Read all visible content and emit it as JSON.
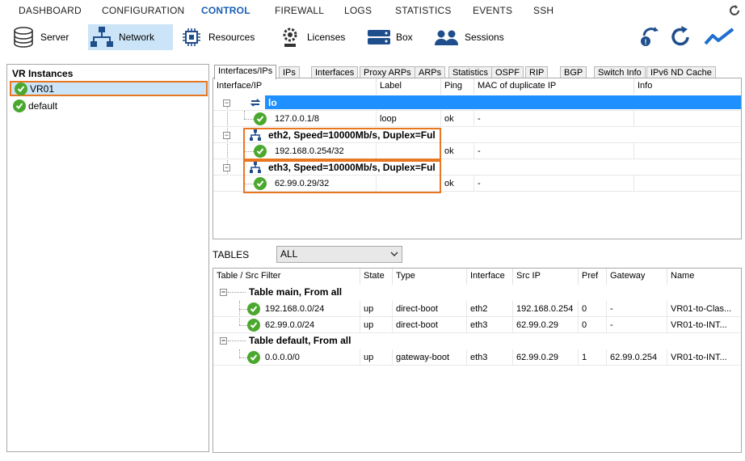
{
  "nav": {
    "items": [
      "DASHBOARD",
      "CONFIGURATION",
      "CONTROL",
      "FIREWALL",
      "LOGS",
      "STATISTICS",
      "EVENTS",
      "SSH"
    ],
    "active": "CONTROL"
  },
  "toolbar": {
    "buttons": [
      {
        "label": "Server",
        "icon": "server-icon"
      },
      {
        "label": "Network",
        "icon": "network-icon"
      },
      {
        "label": "Resources",
        "icon": "chip-icon"
      },
      {
        "label": "Licenses",
        "icon": "gear-license-icon"
      },
      {
        "label": "Box",
        "icon": "box-icon"
      },
      {
        "label": "Sessions",
        "icon": "users-icon"
      }
    ],
    "selected": "Network"
  },
  "vr": {
    "title": "VR Instances",
    "items": [
      {
        "label": "VR01",
        "selected": true
      },
      {
        "label": "default",
        "selected": false
      }
    ]
  },
  "tabs": [
    "Interfaces/IPs",
    "IPs",
    "Interfaces",
    "Proxy ARPs",
    "ARPs",
    "Statistics",
    "OSPF",
    "RIP",
    "BGP",
    "Switch Info",
    "IPv6 ND Cache"
  ],
  "interfaces": {
    "headers": [
      "Interface/IP",
      "Label",
      "Ping",
      "MAC of duplicate IP",
      "Info"
    ],
    "groups": [
      {
        "name": "lo",
        "selected": true,
        "rows": [
          {
            "ip": "127.0.0.1/8",
            "label": "loop",
            "ping": "ok",
            "mac": "-",
            "info": ""
          }
        ]
      },
      {
        "name": "eth2, Speed=10000Mb/s, Duplex=Ful",
        "selected": false,
        "rows": [
          {
            "ip": "192.168.0.254/32",
            "label": "",
            "ping": "ok",
            "mac": "-",
            "info": ""
          }
        ]
      },
      {
        "name": "eth3, Speed=10000Mb/s, Duplex=Ful",
        "selected": false,
        "rows": [
          {
            "ip": "62.99.0.29/32",
            "label": "",
            "ping": "ok",
            "mac": "-",
            "info": ""
          }
        ]
      }
    ]
  },
  "tables": {
    "label": "TABLES",
    "filter": "ALL",
    "headers": [
      "Table / Src Filter",
      "State",
      "Type",
      "Interface",
      "Src IP",
      "Pref",
      "Gateway",
      "Name"
    ],
    "groups": [
      {
        "name": "Table main, From all",
        "rows": [
          {
            "dest": "192.168.0.0/24",
            "state": "up",
            "type": "direct-boot",
            "iface": "eth2",
            "src": "192.168.0.254",
            "pref": "0",
            "gw": "-",
            "name": "VR01-to-Clas..."
          },
          {
            "dest": "62.99.0.0/24",
            "state": "up",
            "type": "direct-boot",
            "iface": "eth3",
            "src": "62.99.0.29",
            "pref": "0",
            "gw": "-",
            "name": "VR01-to-INT..."
          }
        ]
      },
      {
        "name": "Table default, From all",
        "rows": [
          {
            "dest": "0.0.0.0/0",
            "state": "up",
            "type": "gateway-boot",
            "iface": "eth3",
            "src": "62.99.0.29",
            "pref": "1",
            "gw": "62.99.0.254",
            "name": "VR01-to-INT..."
          }
        ]
      }
    ]
  },
  "colors": {
    "accent": "#1a5fb4",
    "selection": "#1e90ff",
    "highlight_box": "#e87722",
    "ok_green": "#4ba82e"
  }
}
